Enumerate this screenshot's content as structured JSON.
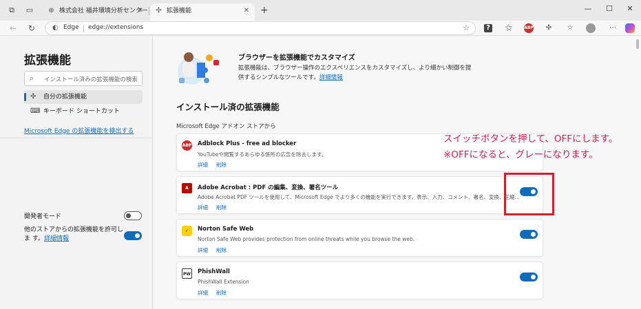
{
  "browser": {
    "tabs": [
      {
        "label": "株式会社 福井環境分析センター",
        "active": false
      },
      {
        "label": "拡張機能",
        "active": true
      }
    ],
    "address": {
      "site": "Edge",
      "url": "edge://extensions"
    },
    "toolbar_icons": [
      "workspaces-icon",
      "tab-actions-icon",
      "help-extension-icon",
      "read-aloud-icon",
      "adblock-plus-icon",
      "extensions-icon",
      "favorites-icon",
      "profile-icon",
      "more-icon",
      "copilot-icon"
    ]
  },
  "sidebar": {
    "title": "拡張機能",
    "search_placeholder": "インストール済みの拡張機能の検索",
    "items": [
      {
        "label": "自分の拡張機能",
        "selected": true
      },
      {
        "label": "キーボード ショートカット",
        "selected": false
      }
    ],
    "discover_link": "Microsoft Edge の拡張機能を検出する",
    "developer_mode_label": "開発者モード",
    "developer_mode_on": false,
    "other_stores_label": "他のストアからの拡張機能を許可しま す。",
    "other_stores_link": "詳細情報",
    "other_stores_on": true
  },
  "main": {
    "promo_title": "ブラウザーを拡張機能でカスタマイズ",
    "promo_body": "拡張機能は、ブラウザー操作のエクスペリエンスをカスタマイズし、より細かい制御を提供するシンプルなツールです。",
    "promo_link": "詳細情報",
    "section_title": "インストール済の拡張機能",
    "source_label": "Microsoft Edge アドオン ストアから",
    "detail_label": "詳細",
    "remove_label": "削除",
    "extensions": [
      {
        "name": "Adblock Plus - free ad blocker",
        "description": "YouTubeや閲覧するあらゆる係所の広告を除去します。",
        "enabled": false,
        "logo_text": "ABP",
        "logo_color": "#d7282f"
      },
      {
        "name": "Adobe Acrobat : PDF の編集、変換、署名ツール",
        "description": "Adobe Acrobat PDF ツールを使用して、Microsoft Edge でより多くの機能を実行できます。表示、入力、コメント、署名、変換、圧縮ツールをお試しくだ...",
        "enabled": true,
        "logo_text": "A",
        "logo_color": "#b30b00"
      },
      {
        "name": "Norton Safe Web",
        "description": "Norton Safe Web provides protection from online threats while you browse the web.",
        "enabled": true,
        "logo_text": "✓",
        "logo_color": "#ffd100"
      },
      {
        "name": "PhishWall",
        "description": "PhishWall Extension",
        "enabled": true,
        "logo_text": "PW",
        "logo_color": "#ffffff"
      }
    ]
  },
  "annotation": {
    "line1": "スイッチボタンを押して、OFFにします。",
    "line2": "※OFFになると、グレーになります。",
    "color": "#e0174a"
  },
  "colors": {
    "accent": "#0f6cbd",
    "highlight_box": "#d0202e"
  }
}
